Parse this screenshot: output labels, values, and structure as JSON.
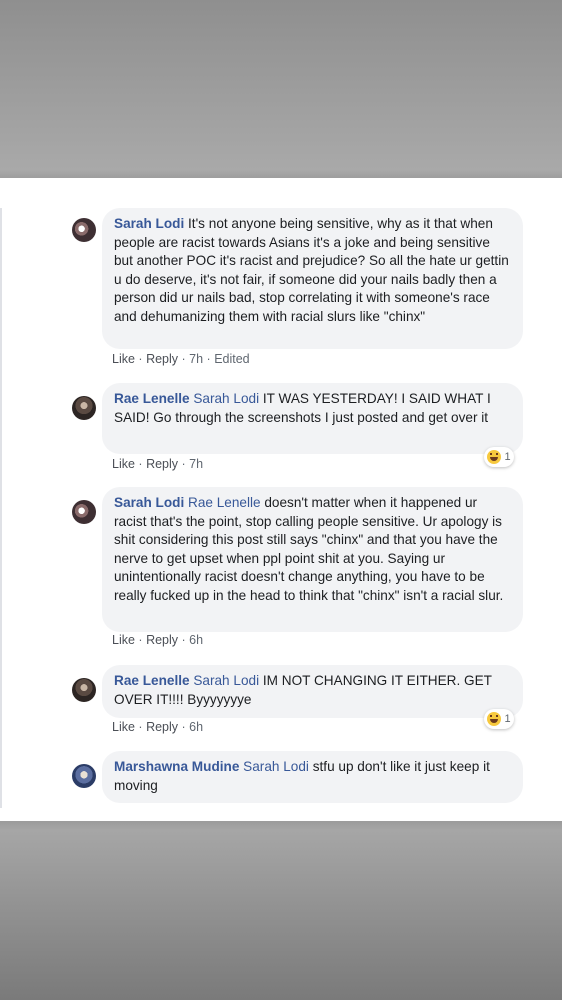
{
  "comments": [
    {
      "author": "Sarah Lodi",
      "mention": "",
      "text": "It's not anyone being sensitive, why as it that when people are racist towards Asians it's a joke and being sensitive but another POC it's racist and prejudice? So all the hate ur gettin u do deserve, it's not fair, if someone did your nails badly then a person did ur nails bad, stop correlating it with someone's race and dehumanizing them with racial slurs like \"chinx\"",
      "like": "Like",
      "reply": "Reply",
      "time": "7h",
      "edited": "Edited",
      "reaction_count": ""
    },
    {
      "author": "Rae Lenelle",
      "mention": "Sarah Lodi",
      "text": "IT WAS YESTERDAY! I SAID WHAT I SAID! Go through the screenshots I just posted and get over it",
      "like": "Like",
      "reply": "Reply",
      "time": "7h",
      "edited": "",
      "reaction_count": "1"
    },
    {
      "author": "Sarah Lodi",
      "mention": "Rae Lenelle",
      "text": "doesn't matter when it happened ur racist that's the point, stop calling people sensitive. Ur apology is shit considering this post still says \"chinx\" and that you have the nerve to get upset when ppl point shit at you. Saying ur unintentionally racist doesn't change anything, you have to be really fucked up in the head to think that \"chinx\" isn't a racial slur.",
      "like": "Like",
      "reply": "Reply",
      "time": "6h",
      "edited": "",
      "reaction_count": ""
    },
    {
      "author": "Rae Lenelle",
      "mention": "Sarah Lodi",
      "text": "IM NOT CHANGING IT EITHER. GET OVER IT!!!! Byyyyyyye",
      "like": "Like",
      "reply": "Reply",
      "time": "6h",
      "edited": "",
      "reaction_count": "1"
    },
    {
      "author": "Marshawna Mudine",
      "mention": "Sarah Lodi",
      "text": "stfu up don't like it just keep it moving",
      "like": "",
      "reply": "",
      "time": "",
      "edited": "",
      "reaction_count": ""
    }
  ],
  "icons": {
    "reaction": "haha-emoji-icon",
    "separator": "·"
  },
  "colors": {
    "name": "#385898",
    "bubble": "#f2f3f5",
    "meta": "#606770"
  }
}
